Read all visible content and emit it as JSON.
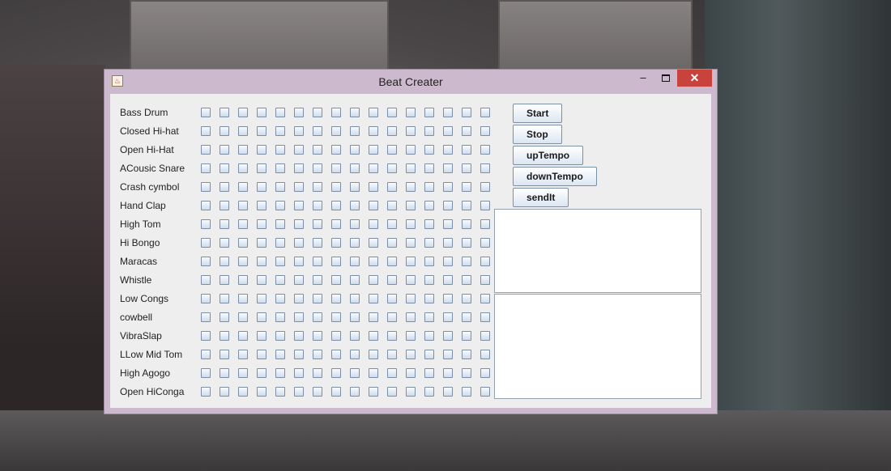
{
  "window": {
    "title": "Beat Creater",
    "app_icon_glyph": "♨",
    "minimize_glyph": "‒",
    "close_glyph": "✕"
  },
  "instruments": [
    "Bass Drum",
    "Closed Hi-hat",
    "Open Hi-Hat",
    "ACousic Snare",
    "Crash cymbol",
    "Hand Clap",
    "High Tom",
    "Hi Bongo",
    "Maracas",
    "Whistle",
    "Low Congs",
    "cowbell",
    "VibraSlap",
    "LLow Mid Tom",
    "High Agogo",
    "Open HiConga"
  ],
  "grid": {
    "rows": 16,
    "columns": 16,
    "all_checked": false
  },
  "buttons": {
    "start": "Start",
    "stop": "Stop",
    "up_tempo": "upTempo",
    "down_tempo": "downTempo",
    "send_it": "sendIt"
  },
  "message_area": {
    "value": ""
  },
  "chat_input": {
    "value": ""
  }
}
